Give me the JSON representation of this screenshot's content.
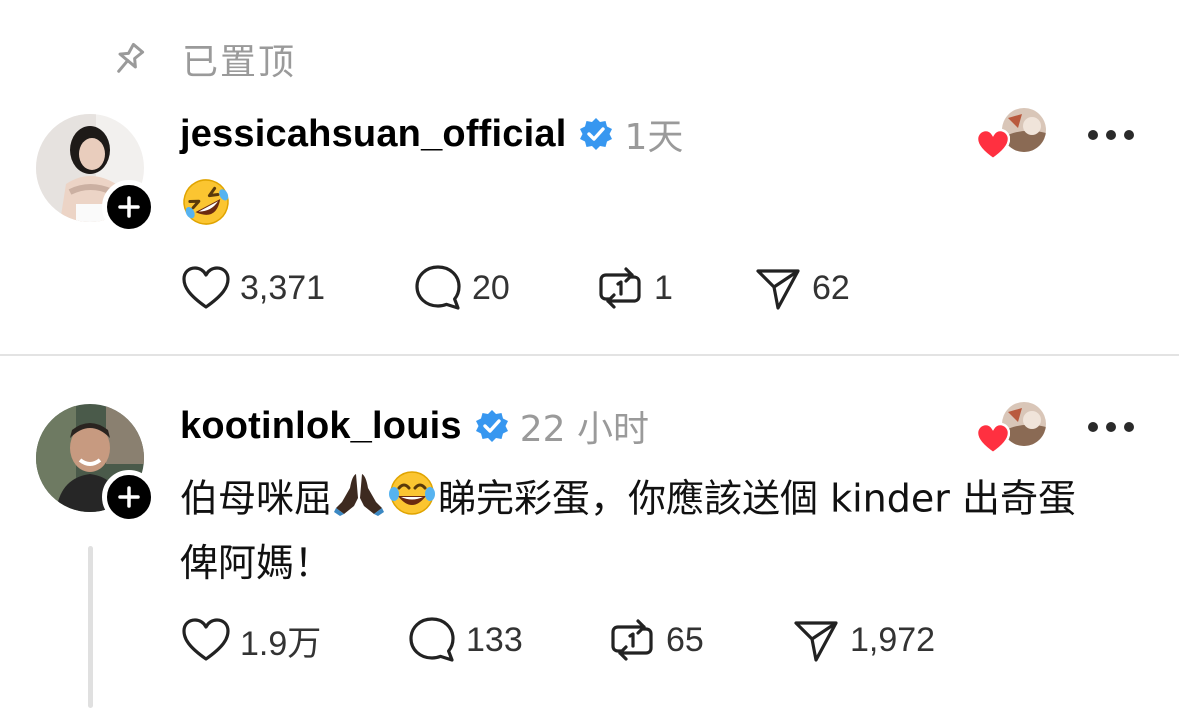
{
  "pinned": {
    "label": "已置顶",
    "icon": "pin-icon"
  },
  "posts": [
    {
      "username": "jessicahsuan_official",
      "verified": true,
      "time": "1天",
      "text": "",
      "text_line2": "",
      "emojis": [
        "rolling-on-floor-laughing"
      ],
      "stats": {
        "likes": "3,371",
        "replies": "20",
        "reposts": "1",
        "shares": "62"
      }
    },
    {
      "username": "kootinlok_louis",
      "verified": true,
      "time": "22 小时",
      "text_part1": "伯母咪屈",
      "text_part2": "睇完彩蛋，你應該送個 kinder 出奇蛋",
      "text_line2": "俾阿媽！",
      "emojis": [
        "folded-hands-dark",
        "face-with-tears-of-joy"
      ],
      "stats": {
        "likes": "1.9万",
        "replies": "133",
        "reposts": "65",
        "shares": "1,972"
      }
    }
  ],
  "colors": {
    "verified": "#3797f0",
    "heart": "#ff3040",
    "muted": "#9a9a9a"
  }
}
